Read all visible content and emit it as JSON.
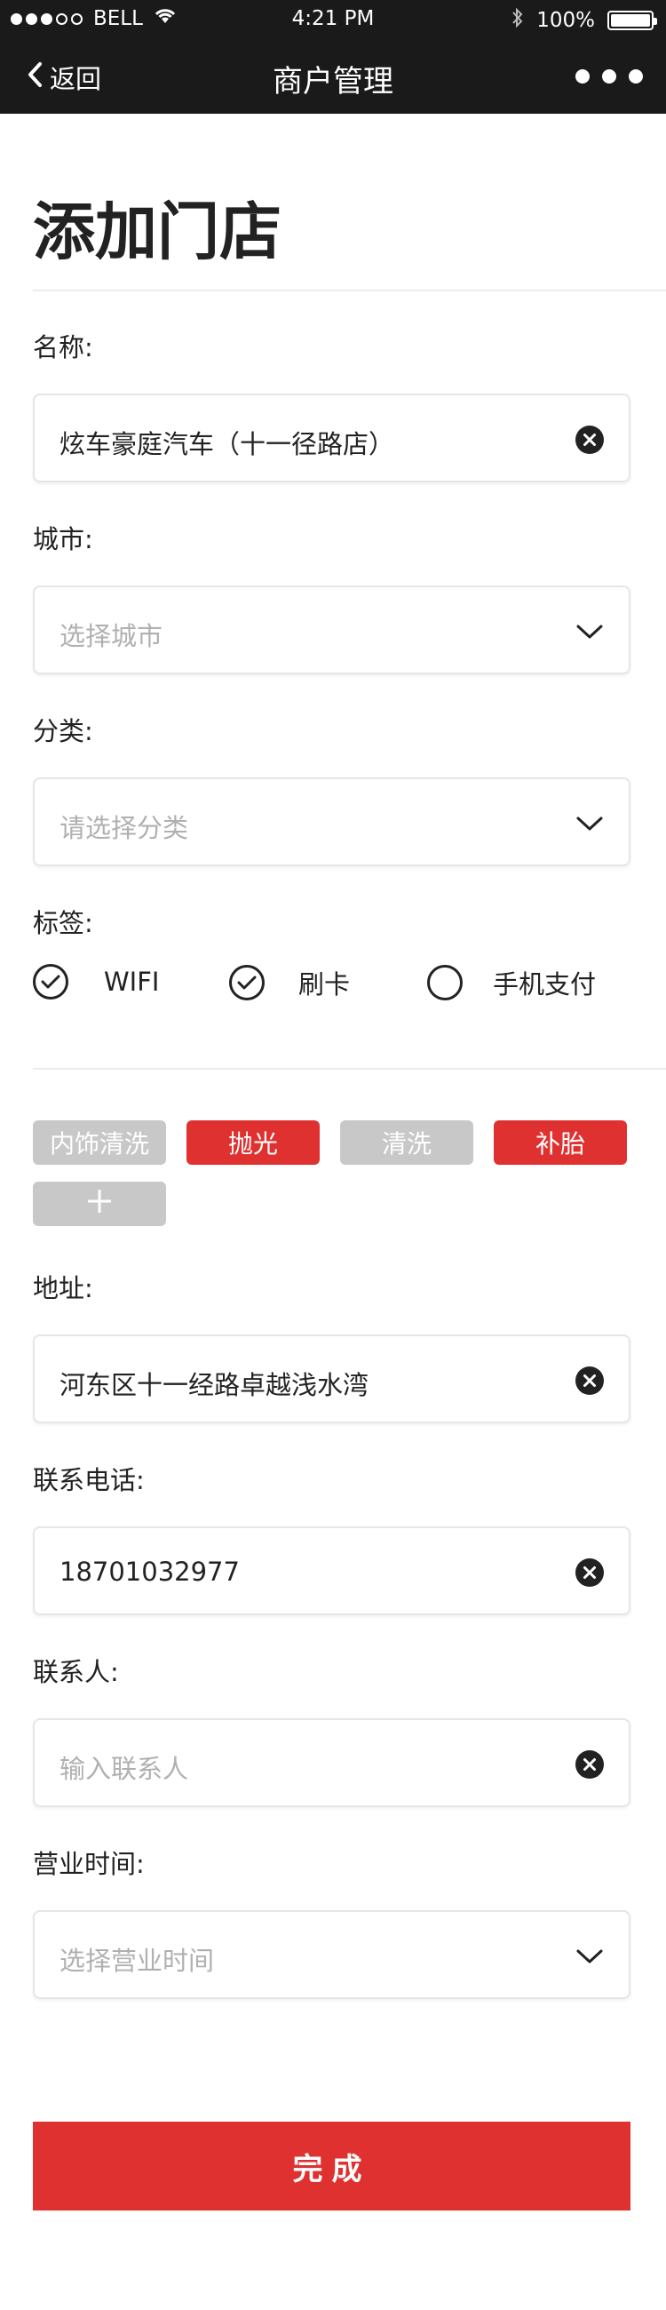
{
  "status_bar": {
    "carrier": "BELL",
    "time": "4:21 PM",
    "battery": "100%",
    "battery_level": 1.0
  },
  "nav": {
    "back_label": "返回",
    "title": "商户管理"
  },
  "page": {
    "title": "添加门店"
  },
  "form": {
    "name": {
      "label": "名称:",
      "value": "炫车豪庭汽车（十一径路店）"
    },
    "city": {
      "label": "城市:",
      "placeholder": "选择城市"
    },
    "category": {
      "label": "分类:",
      "placeholder": "请选择分类"
    },
    "tags_label": "标签:",
    "options": [
      {
        "label": "WIFI",
        "checked": true
      },
      {
        "label": "刷卡",
        "checked": true
      },
      {
        "label": "手机支付",
        "checked": false
      }
    ],
    "tags": [
      {
        "label": "内饰清洗",
        "active": false
      },
      {
        "label": "抛光",
        "active": true
      },
      {
        "label": "清洗",
        "active": false
      },
      {
        "label": "补胎",
        "active": true
      }
    ],
    "add_tag": "+",
    "address": {
      "label": "地址:",
      "value": "河东区十一经路卓越浅水湾"
    },
    "phone": {
      "label": "联系电话:",
      "value": "18701032977"
    },
    "contact": {
      "label": "联系人:",
      "placeholder": "输入联系人"
    },
    "hours": {
      "label": "营业时间:",
      "placeholder": "选择营业时间"
    },
    "submit_label": "完成"
  },
  "colors": {
    "accent": "#e03131",
    "bar": "#1a1a1a",
    "tag_inactive": "#c8c8c8"
  },
  "icons": [
    "wifi-icon",
    "bluetooth-icon",
    "battery-icon",
    "back-chevron-icon",
    "more-dots-icon",
    "clear-icon",
    "chevron-down-icon",
    "check-icon",
    "plus-icon"
  ]
}
